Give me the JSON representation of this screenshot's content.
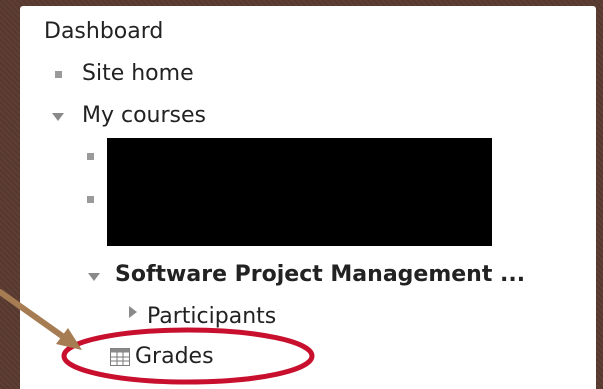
{
  "nav": {
    "dashboard": "Dashboard",
    "site_home": "Site home",
    "my_courses": "My courses",
    "course": "Software Project Management ...",
    "participants": "Participants",
    "grades": "Grades"
  },
  "colors": {
    "background": "#5a3a30",
    "highlight_ellipse": "#c8102e",
    "arrow": "#a67c52"
  }
}
